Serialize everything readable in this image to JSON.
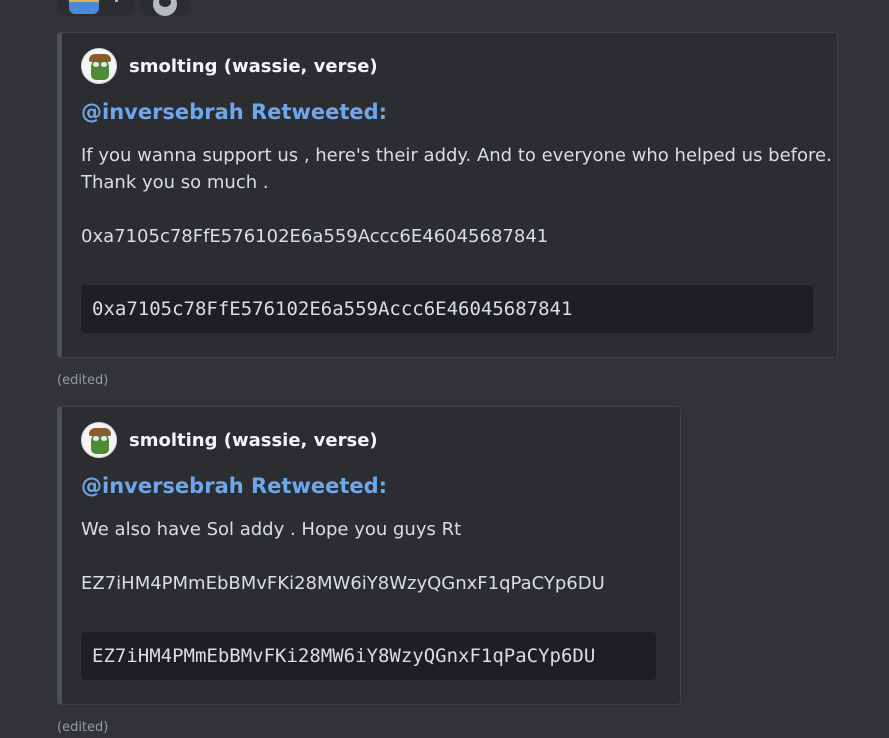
{
  "messages": [
    {
      "author": "smolting (wassie, verse)",
      "title": "@inversebrah Retweeted:",
      "line1": "If you wanna support us , here's their addy. And to everyone who helped us before.",
      "line2": "Thank you so much .",
      "address": "0xa7105c78FfE576102E6a559Accc6E46045687841",
      "code": "0xa7105c78FfE576102E6a559Accc6E46045687841",
      "edited": "(edited)"
    },
    {
      "author": "smolting (wassie, verse)",
      "title": "@inversebrah Retweeted:",
      "line1": "We also have Sol addy . Hope you guys Rt",
      "address": "EZ7iHM4PMmEbBMvFKi28MW6iY8WzyQGnxF1qPaCYp6DU",
      "code": "EZ7iHM4PMmEbBMvFKi28MW6iY8WzyQGnxF1qPaCYp6DU",
      "edited": "(edited)"
    }
  ],
  "colors": {
    "background": "#313338",
    "embed_bg": "#2b2d31",
    "title_link": "#6ea7ec",
    "code_bg": "#1e1f22"
  }
}
